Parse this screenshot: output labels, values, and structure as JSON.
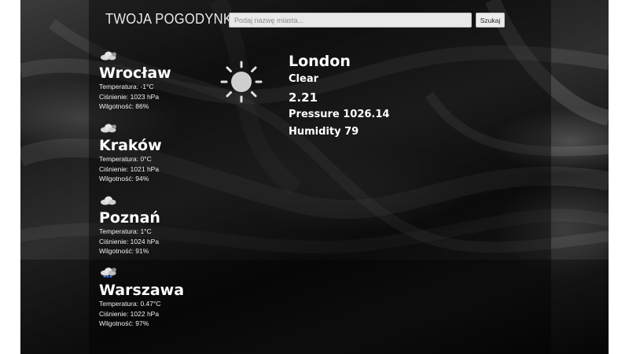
{
  "app": {
    "brand": "TWOJA POGODYNKA"
  },
  "search": {
    "placeholder": "Podaj nazwę miasta...",
    "value": "",
    "button_label": "Szukaj"
  },
  "cities": [
    {
      "name": "Wrocław",
      "icon": "cloud-icon",
      "temperature": "Temperatura: -1°C",
      "pressure": "Ciśnienie: 1023 hPa",
      "humidity": "Wilgotność: 86%"
    },
    {
      "name": "Kraków",
      "icon": "cloud-icon",
      "temperature": "Temperatura: 0°C",
      "pressure": "Ciśnienie: 1021 hPa",
      "humidity": "Wilgotność: 94%"
    },
    {
      "name": "Poznań",
      "icon": "cloud-icon",
      "temperature": "Temperatura: 1°C",
      "pressure": "Ciśnienie: 1024 hPa",
      "humidity": "Wilgotność: 91%"
    },
    {
      "name": "Warszawa",
      "icon": "rain-cloud-icon",
      "temperature": "Temperatura: 0.47°C",
      "pressure": "Ciśnienie: 1022 hPa",
      "humidity": "Wilgotność: 97%"
    }
  ],
  "current": {
    "icon": "sun-icon",
    "city": "London",
    "condition": "Clear",
    "temperature": "2.21",
    "pressure": "Pressure 1026.14",
    "humidity": "Humidity 79"
  },
  "colors": {
    "text": "#ffffff",
    "panel_overlay": "rgba(0,0,0,0.42)",
    "input_background": "#e8e8e8",
    "rain_drops": "#3b6fd6"
  }
}
